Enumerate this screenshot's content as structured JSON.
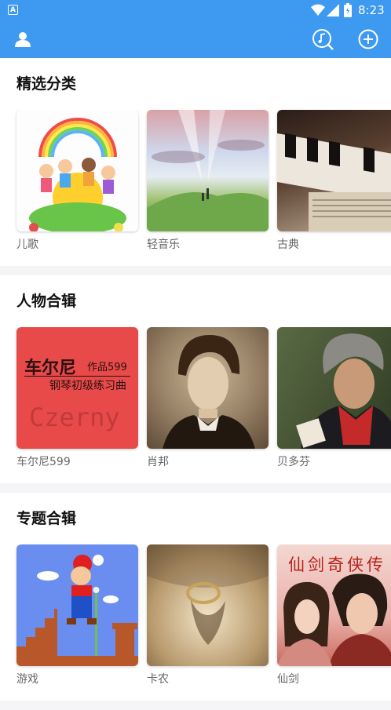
{
  "status_bar": {
    "time": "8:23",
    "icons": [
      "notification-a-icon",
      "wifi-icon",
      "signal-icon",
      "battery-icon"
    ]
  },
  "app_bar": {
    "left_icon": "user-icon",
    "right_icons": [
      "music-search-icon",
      "add-icon"
    ]
  },
  "sections": [
    {
      "title": "精选分类",
      "items": [
        {
          "label": "儿歌"
        },
        {
          "label": "轻音乐"
        },
        {
          "label": "古典"
        }
      ]
    },
    {
      "title": "人物合辑",
      "items": [
        {
          "label": "车尔尼599",
          "cover": {
            "title": "车尔尼",
            "opus": "作品599",
            "subtitle": "钢琴初级练习曲",
            "watermark": "Czerny"
          }
        },
        {
          "label": "肖邦"
        },
        {
          "label": "贝多芬"
        }
      ]
    },
    {
      "title": "专题合辑",
      "items": [
        {
          "label": "游戏"
        },
        {
          "label": "卡农"
        },
        {
          "label": "仙剑",
          "cover": {
            "title": "仙剑奇侠传"
          }
        }
      ]
    }
  ],
  "colors": {
    "app_bar": "#3d9af0",
    "czerny_cover": "#e84a4a"
  }
}
